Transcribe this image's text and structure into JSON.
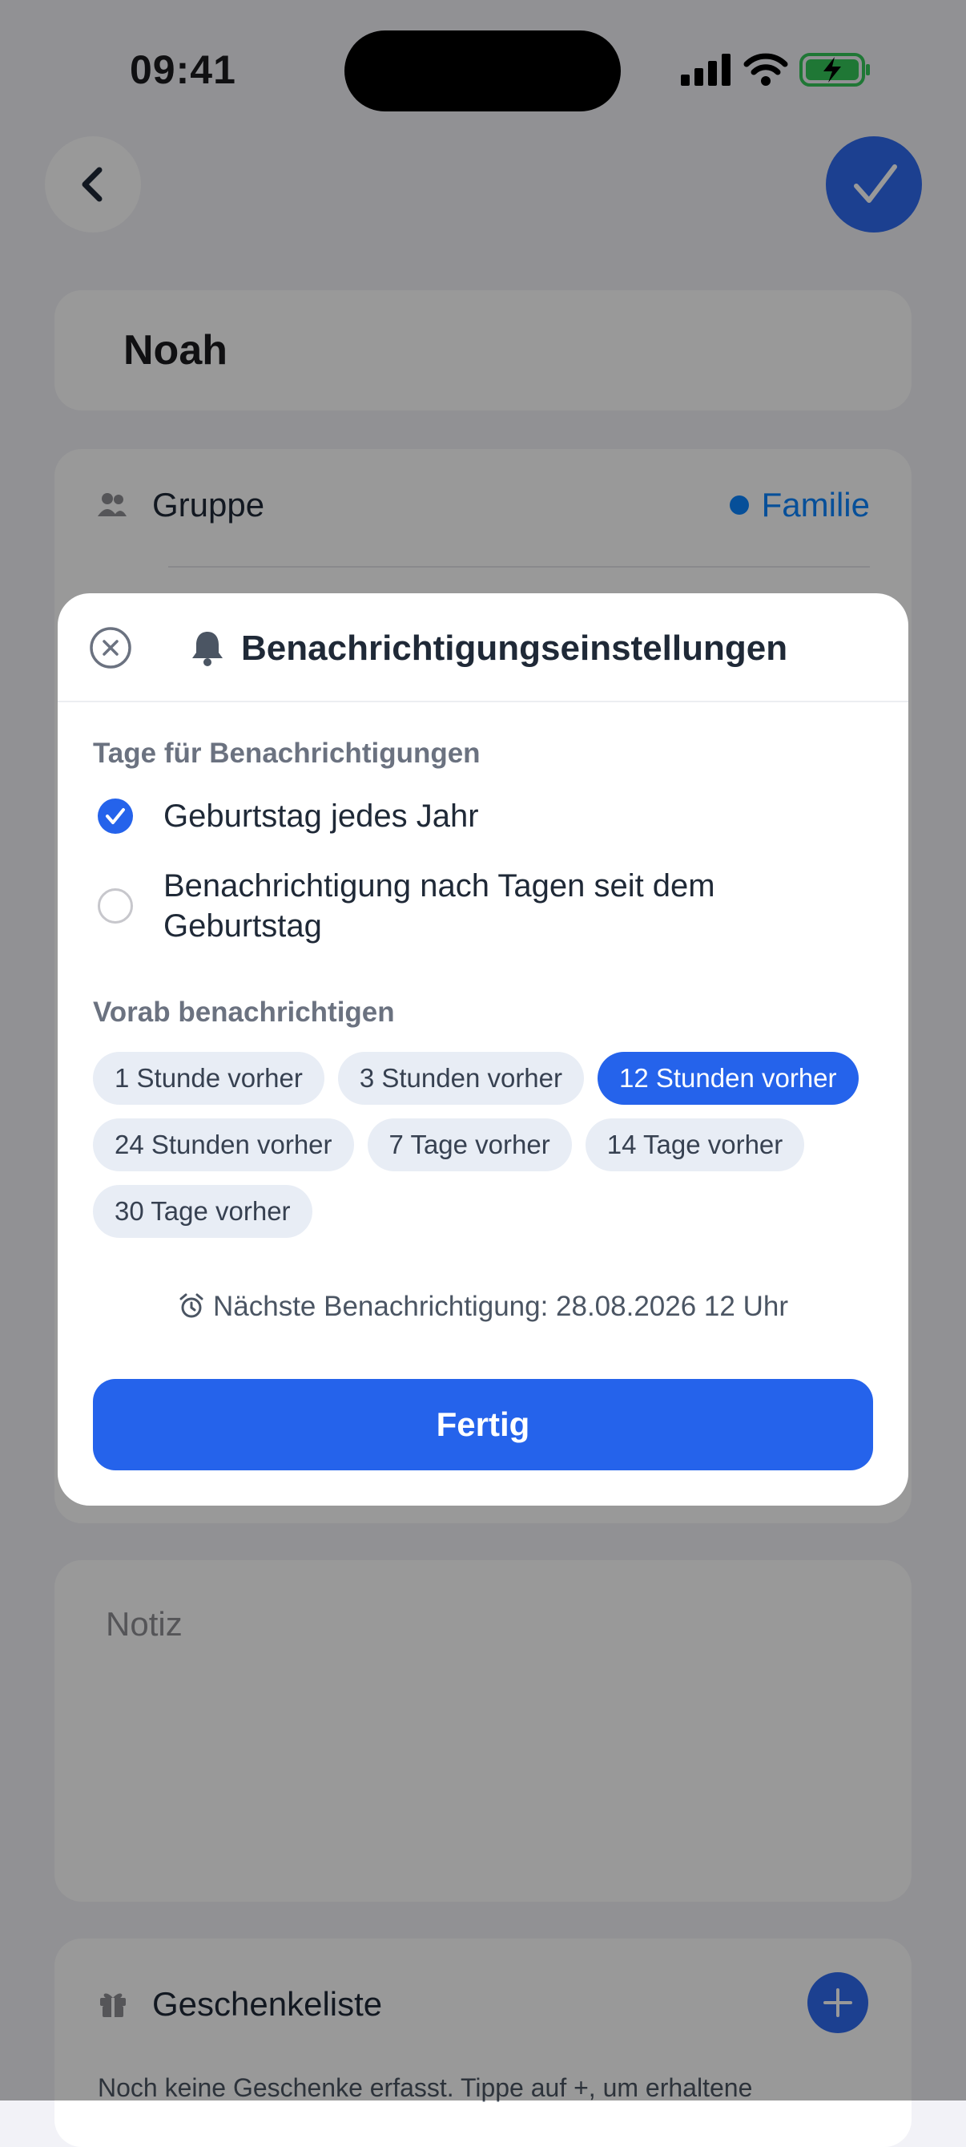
{
  "status": {
    "time": "09:41"
  },
  "contact": {
    "name": "Noah",
    "group_label": "Gruppe",
    "group_value": "Familie",
    "note_placeholder": "Notiz"
  },
  "gifts": {
    "title": "Geschenkeliste",
    "empty_text": "Noch keine Geschenke erfasst. Tippe auf +, um erhaltene"
  },
  "modal": {
    "title": "Benachrichtigungseinstellungen",
    "days_label": "Tage für Benachrichtigungen",
    "options": [
      {
        "label": "Geburtstag jedes Jahr",
        "selected": true
      },
      {
        "label_line1": "Benachrichtigung nach Tagen seit dem",
        "label_line2": "Geburtstag",
        "selected": false
      }
    ],
    "advance_label": "Vorab benachrichtigen",
    "chips": [
      {
        "label": "1 Stunde vorher",
        "selected": false
      },
      {
        "label": "3 Stunden vorher",
        "selected": false
      },
      {
        "label": "12 Stunden vorher",
        "selected": true
      },
      {
        "label": "24 Stunden vorher",
        "selected": false
      },
      {
        "label": "7 Tage vorher",
        "selected": false
      },
      {
        "label": "14 Tage vorher",
        "selected": false
      },
      {
        "label": "30 Tage vorher",
        "selected": false
      }
    ],
    "next_notification": "Nächste Benachrichtigung: 28.08.2026 12 Uhr",
    "done_label": "Fertig"
  },
  "colors": {
    "accent": "#2563eb",
    "group_dot": "#0a84ff",
    "battery": "#34c759"
  }
}
